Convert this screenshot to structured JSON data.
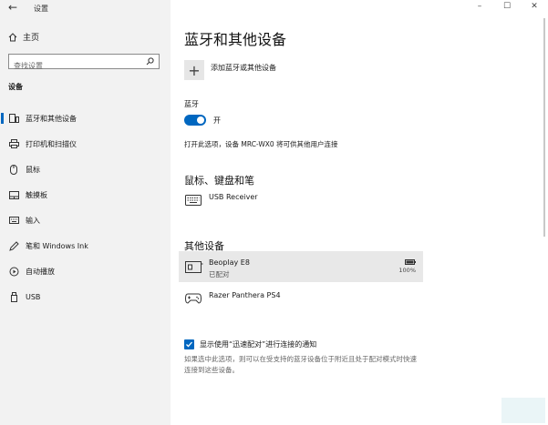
{
  "window": {
    "back_glyph": "←",
    "title": "设置",
    "controls": {
      "minimize": "–",
      "maximize": "☐",
      "close": "✕"
    }
  },
  "sidebar": {
    "home_label": "主页",
    "search_placeholder": "查找设置",
    "section_heading": "设备",
    "items": [
      {
        "label": "蓝牙和其他设备",
        "icon": "bluetooth-devices-icon",
        "active": true
      },
      {
        "label": "打印机和扫描仪",
        "icon": "printer-icon",
        "active": false
      },
      {
        "label": "鼠标",
        "icon": "mouse-icon",
        "active": false
      },
      {
        "label": "触摸板",
        "icon": "touchpad-icon",
        "active": false
      },
      {
        "label": "输入",
        "icon": "keyboard-icon",
        "active": false
      },
      {
        "label": "笔和 Windows Ink",
        "icon": "pen-icon",
        "active": false
      },
      {
        "label": "自动播放",
        "icon": "autoplay-icon",
        "active": false
      },
      {
        "label": "USB",
        "icon": "usb-icon",
        "active": false
      }
    ]
  },
  "main": {
    "title": "蓝牙和其他设备",
    "add_device_label": "添加蓝牙或其他设备",
    "bluetooth": {
      "label": "蓝牙",
      "state_label": "开",
      "discoverable_text": "打开此选项，设备 MRC-WX0 将可供其他用户连接"
    },
    "mouse_section": {
      "heading": "鼠标、键盘和笔",
      "devices": [
        {
          "name": "USB Receiver",
          "icon": "keyboard-icon"
        }
      ]
    },
    "other_section": {
      "heading": "其他设备",
      "devices": [
        {
          "name": "Beoplay E8",
          "status": "已配对",
          "battery": "100%",
          "icon": "audio-device-icon"
        },
        {
          "name": "Razer Panthera PS4",
          "icon": "gamepad-icon"
        }
      ]
    },
    "swift_pair": {
      "label": "显示使用“迅速配对”进行连接的通知",
      "description": "如果选中此选项，则可以在受支持的蓝牙设备位于附近且处于配对模式时快速连接到这些设备。",
      "checked": true
    }
  },
  "colors": {
    "accent": "#0067c0",
    "sidebar_bg": "#f2f2f2",
    "selected_row": "#e8e8e8"
  }
}
